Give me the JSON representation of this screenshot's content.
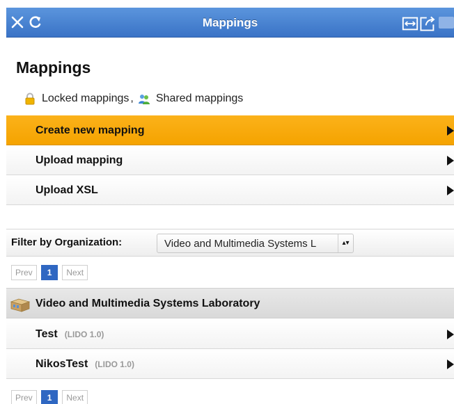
{
  "titlebar": {
    "title": "Mappings",
    "color": "#3f7bd0"
  },
  "page": {
    "heading": "Mappings"
  },
  "legend": {
    "locked_label": "Locked mappings",
    "separator": ",",
    "shared_label": "Shared mappings"
  },
  "menu": {
    "items": [
      {
        "label": "Create new mapping",
        "active": true
      },
      {
        "label": "Upload mapping",
        "active": false
      },
      {
        "label": "Upload XSL",
        "active": false
      }
    ],
    "active_color": "#f5a300"
  },
  "filter": {
    "label": "Filter by Organization:",
    "selected": "Video and Multimedia Systems L"
  },
  "pager": {
    "prev": "Prev",
    "current": "1",
    "next": "Next"
  },
  "group": {
    "name": "Video and Multimedia Systems Laboratory"
  },
  "mappings": [
    {
      "name": "Test",
      "schema": "(LIDO 1.0)"
    },
    {
      "name": "NikosTest",
      "schema": "(LIDO 1.0)"
    }
  ]
}
